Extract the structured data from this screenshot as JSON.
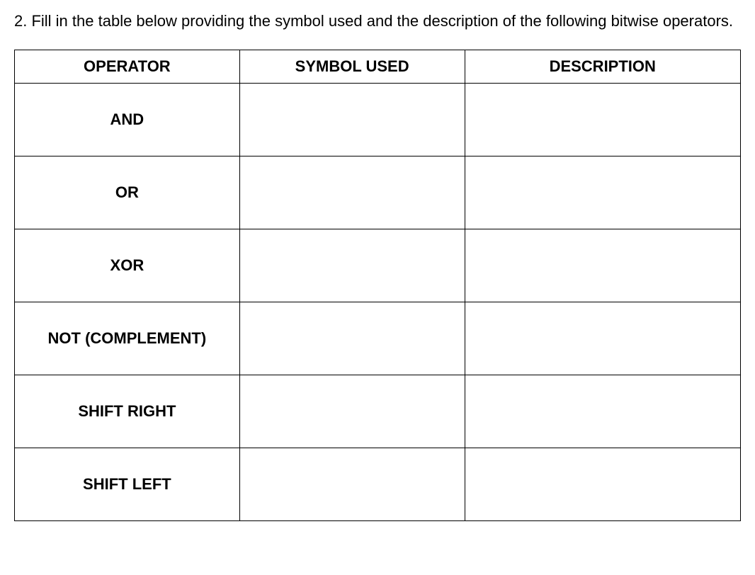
{
  "prompt": "2. Fill in the table below providing the symbol used and the description of the following bitwise operators.",
  "table": {
    "headers": [
      "OPERATOR",
      "SYMBOL USED",
      "DESCRIPTION"
    ],
    "rows": [
      {
        "operator": "AND",
        "symbol": "",
        "description": ""
      },
      {
        "operator": "OR",
        "symbol": "",
        "description": ""
      },
      {
        "operator": "XOR",
        "symbol": "",
        "description": ""
      },
      {
        "operator": "NOT (COMPLEMENT)",
        "symbol": "",
        "description": ""
      },
      {
        "operator": "SHIFT RIGHT",
        "symbol": "",
        "description": ""
      },
      {
        "operator": "SHIFT LEFT",
        "symbol": "",
        "description": ""
      }
    ]
  }
}
